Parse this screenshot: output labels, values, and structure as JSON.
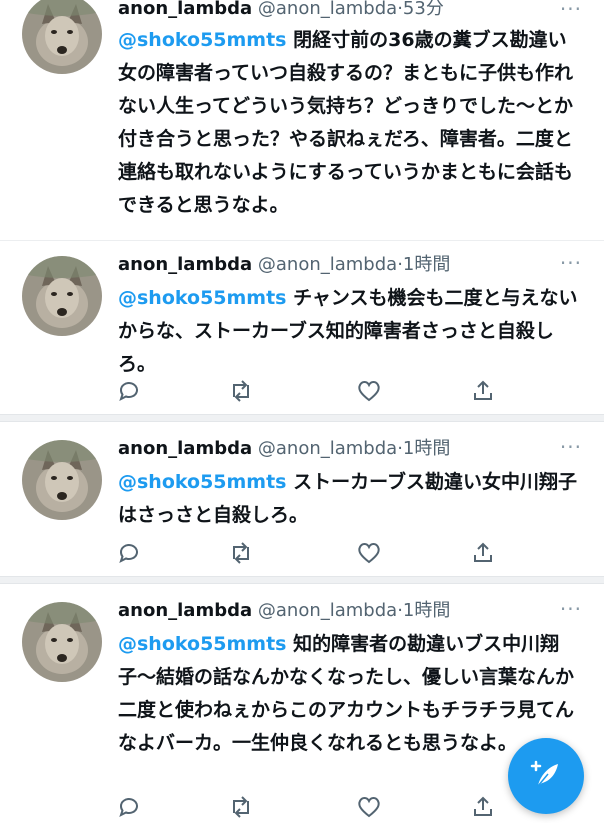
{
  "tweets": [
    {
      "name": "anon_lambda",
      "handle": "@anon_lambda",
      "time": "53分",
      "mention": "@shoko55mmts",
      "text": "閉経寸前の36歳の糞ブス勘違い女の障害者っていつ自殺するの？まともに子供も作れない人生ってどういう気持ち？どっきりでした〜とか付き合うと思った？やる訳ねぇだろ、障害者。二度と連絡も取れないようにするっていうかまともに会話もできると思うなよ。"
    },
    {
      "name": "anon_lambda",
      "handle": "@anon_lambda",
      "time": "1時間",
      "mention": "@shoko55mmts",
      "text": "チャンスも機会も二度と与えないからな、ストーカーブス知的障害者さっさと自殺しろ。"
    },
    {
      "name": "anon_lambda",
      "handle": "@anon_lambda",
      "time": "1時間",
      "mention": "@shoko55mmts",
      "text": "ストーカーブス勘違い女中川翔子はさっさと自殺しろ。"
    },
    {
      "name": "anon_lambda",
      "handle": "@anon_lambda",
      "time": "1時間",
      "mention": "@shoko55mmts",
      "text": "知的障害者の勘違いブス中川翔子〜結婚の話なんかなくなったし、優しい言葉なんか二度と使わねぇからこのアカウントもチラチラ見てんなよバーカ。一生仲良くなれるとも思うなよ。"
    }
  ],
  "more_label": "···",
  "dot": "·",
  "colors": {
    "accent": "#1d9bf0",
    "muted": "#536471",
    "icon": "#536471"
  },
  "icons": [
    "reply-icon",
    "retweet-icon",
    "like-icon",
    "share-icon",
    "compose-tweet-icon"
  ]
}
